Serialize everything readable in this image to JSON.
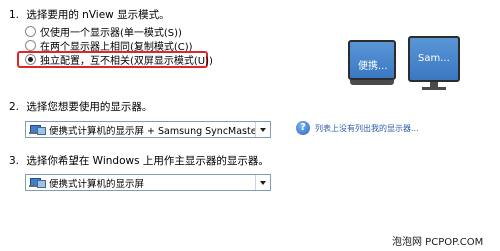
{
  "step1": {
    "number": "1.",
    "title": "选择要用的 nView 显示模式。",
    "options": [
      {
        "label": "仅使用一个显示器(单一模式(S))",
        "checked": false
      },
      {
        "label": "在两个显示器上相同(复制模式(C))",
        "checked": false
      },
      {
        "label": "独立配置，互不相关(双屏显示模式(U))",
        "checked": true
      }
    ],
    "preview": {
      "monitor1_label": "便携...",
      "monitor2_label": "Sam..."
    }
  },
  "step2": {
    "number": "2.",
    "title": "选择您想要使用的显示器。",
    "select_value": "便携式计算机的显示屏 + Samsung SyncMaste",
    "help_link": "列表上没有列出我的显示器..."
  },
  "step3": {
    "number": "3.",
    "title": "选择你希望在 Windows 上用作主显示器的显示器。",
    "select_value": "便携式计算机的显示屏"
  },
  "watermark": "泡泡网  PCPOP.COM",
  "colors": {
    "highlight": "#e0262b",
    "screen": "#3a78c2",
    "link": "#2c5fa8"
  }
}
